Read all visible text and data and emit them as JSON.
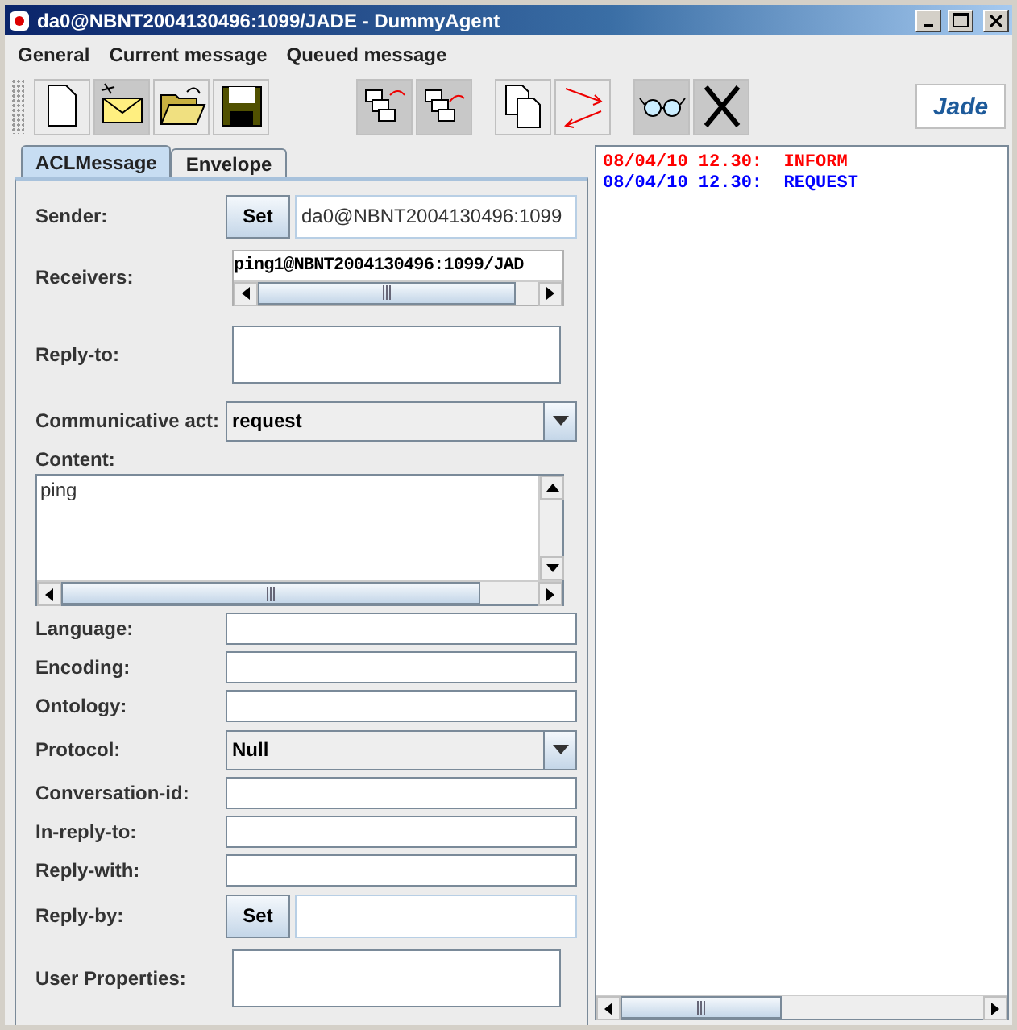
{
  "window": {
    "title": "da0@NBNT2004130496:1099/JADE - DummyAgent"
  },
  "menu": [
    "General",
    "Current message",
    "Queued message"
  ],
  "logo": "Jade",
  "tabs": [
    {
      "label": "ACLMessage",
      "selected": true
    },
    {
      "label": "Envelope",
      "selected": false
    }
  ],
  "fields": [
    {
      "kind": "set",
      "label": "Sender:",
      "button": "Set",
      "value": "da0@NBNT2004130496:1099"
    },
    {
      "kind": "scroll",
      "label": "Receivers:",
      "value": "ping1@NBNT2004130496:1099/JAD"
    },
    {
      "kind": "area",
      "label": "Reply-to:"
    },
    {
      "kind": "combo",
      "label": "Communicative act:",
      "value": "request"
    },
    {
      "kind": "content",
      "label": "Content:",
      "value": "ping"
    },
    {
      "kind": "text",
      "label": "Language:"
    },
    {
      "kind": "text",
      "label": "Encoding:"
    },
    {
      "kind": "text",
      "label": "Ontology:"
    },
    {
      "kind": "combo",
      "label": "Protocol:",
      "value": "Null"
    },
    {
      "kind": "text",
      "label": "Conversation-id:"
    },
    {
      "kind": "text",
      "label": "In-reply-to:"
    },
    {
      "kind": "text",
      "label": "Reply-with:"
    },
    {
      "kind": "set",
      "label": "Reply-by:",
      "button": "Set"
    },
    {
      "kind": "area",
      "label": "User Properties:"
    }
  ],
  "messages": [
    {
      "time": "08/04/10 12.30:",
      "performative": "INFORM",
      "color": "#ff0000"
    },
    {
      "time": "08/04/10 12.30:",
      "performative": "REQUEST",
      "color": "#0000ff"
    }
  ]
}
